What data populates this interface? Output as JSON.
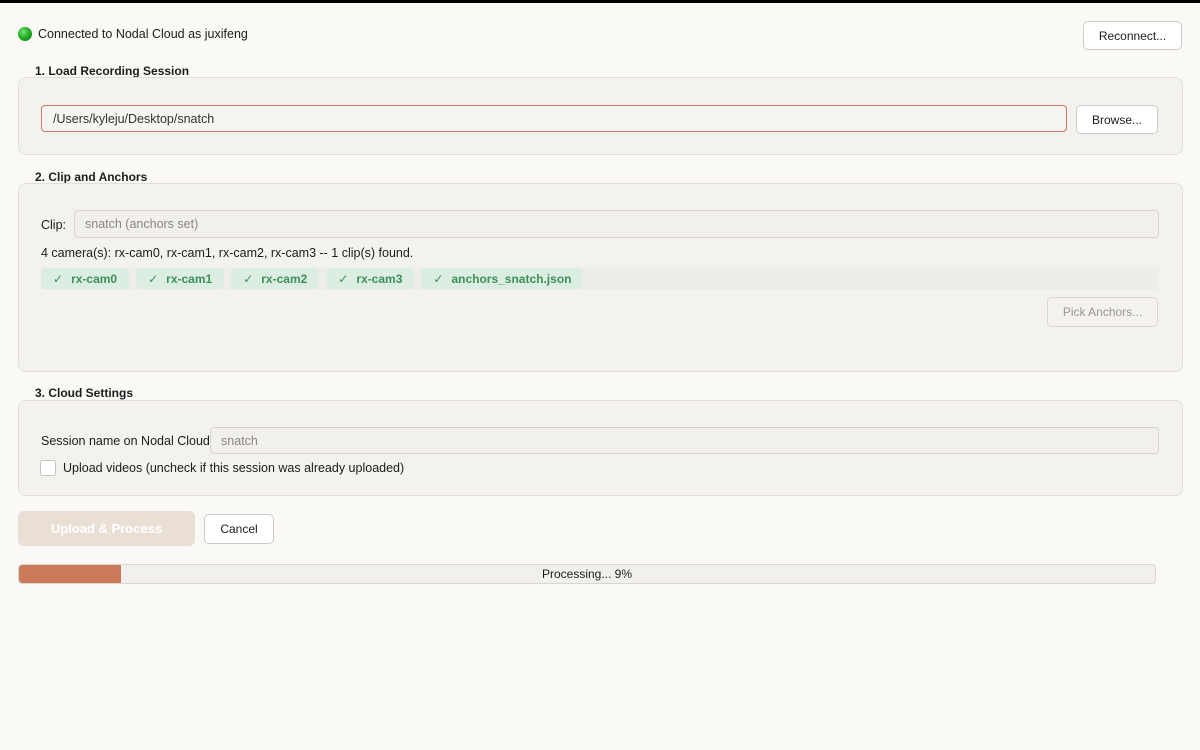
{
  "status": {
    "text": "Connected to Nodal Cloud as juxifeng",
    "color": "#22b025"
  },
  "header": {
    "reconnect_label": "Reconnect..."
  },
  "section1": {
    "title": "1. Load Recording Session",
    "path_value": "/Users/kyleju/Desktop/snatch",
    "browse_label": "Browse..."
  },
  "section2": {
    "title": "2. Clip and Anchors",
    "clip_label": "Clip:",
    "clip_value": "snatch  (anchors set)",
    "summary": "4 camera(s): rx-cam0, rx-cam1, rx-cam2, rx-cam3  --  1 clip(s) found.",
    "chips": [
      {
        "check": "✓",
        "label": "rx-cam0"
      },
      {
        "check": "✓",
        "label": "rx-cam1"
      },
      {
        "check": "✓",
        "label": "rx-cam2"
      },
      {
        "check": "✓",
        "label": "rx-cam3"
      },
      {
        "check": "✓",
        "label": "anchors_snatch.json"
      }
    ],
    "pick_anchors_label": "Pick Anchors..."
  },
  "section3": {
    "title": "3. Cloud Settings",
    "session_label": "Session name on Nodal Cloud:",
    "session_placeholder": "snatch",
    "upload_checkbox_label": "Upload videos (uncheck if this session was already uploaded)",
    "upload_checked": false
  },
  "actions": {
    "upload_label": "Upload & Process",
    "cancel_label": "Cancel"
  },
  "progress": {
    "text": "Processing... 9%",
    "value": 0.09,
    "color": "#cc7a5c"
  }
}
